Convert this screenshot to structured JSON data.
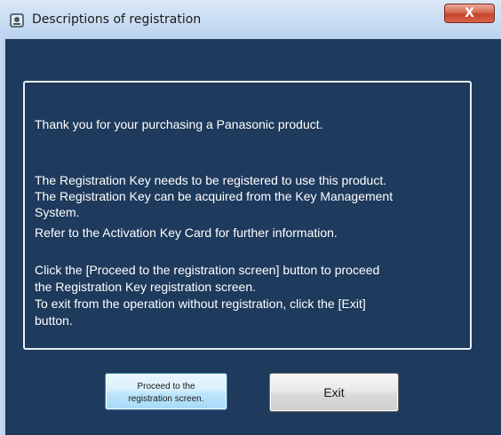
{
  "window": {
    "title": "Descriptions of registration",
    "close_glyph": "X",
    "icon": "app-icon"
  },
  "message": {
    "lines": [
      "Thank you for your purchasing a Panasonic product.",
      "The Registration Key needs to be registered to use this product.",
      "The Registration Key can be acquired from the Key Management",
      "System.",
      "Refer to the Activation Key Card for further information.",
      "Click the [Proceed to the registration screen] button to proceed",
      "the Registration Key registration screen.",
      "To exit from the operation without registration, click the [Exit]",
      "button."
    ]
  },
  "buttons": {
    "proceed_line1": "Proceed to the",
    "proceed_line2": "registration screen.",
    "exit": "Exit"
  },
  "colors": {
    "panel_background": "#1e3a5c",
    "message_text": "#ffffff",
    "close_button": "#c6452b"
  }
}
